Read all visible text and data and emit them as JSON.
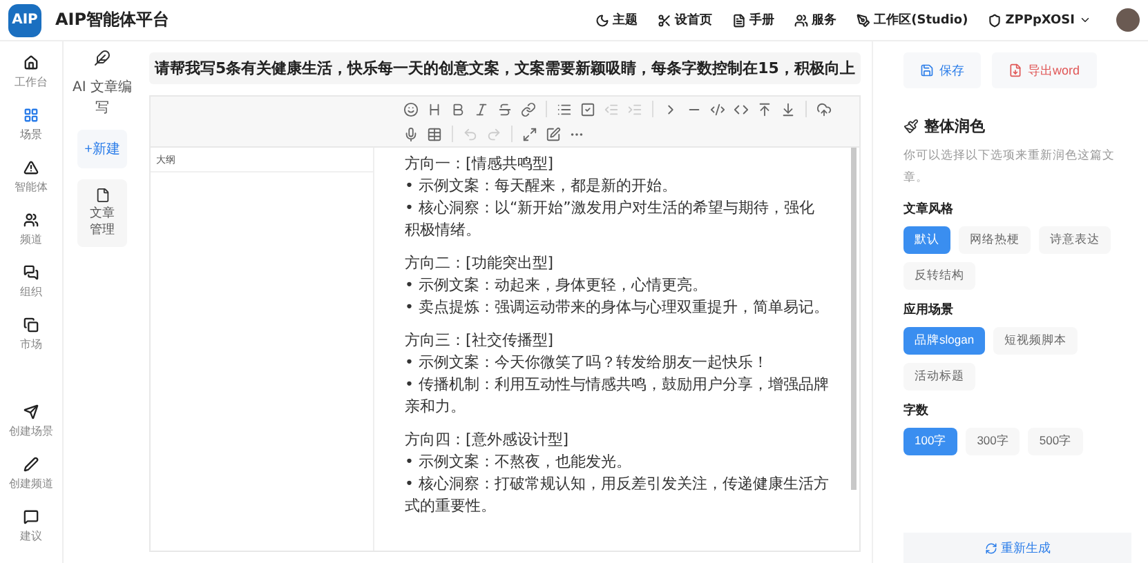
{
  "app": {
    "logo": "AIP",
    "title": "AIP智能体平台"
  },
  "header_links": [
    {
      "kind": "theme",
      "label": "主题"
    },
    {
      "kind": "home",
      "label": "设首页"
    },
    {
      "kind": "manual",
      "label": "手册"
    },
    {
      "kind": "service",
      "label": "服务"
    },
    {
      "kind": "studio",
      "label": "工作区(Studio)"
    },
    {
      "kind": "account",
      "label": "ZPPpXOSI"
    }
  ],
  "sidebar": {
    "items": [
      {
        "kind": "home",
        "label": "工作台",
        "selected": false
      },
      {
        "kind": "scene",
        "label": "场景",
        "selected": true
      },
      {
        "kind": "agent",
        "label": "智能体",
        "selected": false
      },
      {
        "kind": "channel",
        "label": "频道",
        "selected": false
      },
      {
        "kind": "org",
        "label": "组织",
        "selected": false
      },
      {
        "kind": "market",
        "label": "市场",
        "selected": false
      }
    ],
    "actions": [
      {
        "kind": "send",
        "label": "创建场景"
      },
      {
        "kind": "pen",
        "label": "创建频道"
      },
      {
        "kind": "chat",
        "label": "建议"
      }
    ]
  },
  "subnav": {
    "title": "AI 文章编写",
    "new_button": "+新建",
    "items": [
      {
        "label": "文章管理"
      }
    ]
  },
  "prompt": "请帮我写5条有关健康生活，快乐每一天的创意文案，文案需要新颖吸睛，每条字数控制在15，积极向上",
  "editor": {
    "outline_label": "大纲",
    "sections": [
      {
        "title": "方向一：[情感共鸣型]",
        "lines": [
          "• 示例文案：每天醒来，都是新的开始。",
          "• 核心洞察：以“新开始”激发用户对生活的希望与期待，强化积极情绪。"
        ]
      },
      {
        "title": "方向二：[功能突出型]",
        "lines": [
          "• 示例文案：动起来，身体更轻，心情更亮。",
          "• 卖点提炼：强调运动带来的身体与心理双重提升，简单易记。"
        ]
      },
      {
        "title": "方向三：[社交传播型]",
        "lines": [
          "• 示例文案：今天你微笑了吗？转发给朋友一起快乐！",
          "• 传播机制：利用互动性与情感共鸣，鼓励用户分享，增强品牌亲和力。"
        ]
      },
      {
        "title": "方向四：[意外感设计型]",
        "lines": [
          "• 示例文案：不熬夜，也能发光。",
          "• 核心洞察：打破常规认知，用反差引发关注，传递健康生活方式的重要性。"
        ]
      }
    ]
  },
  "panel": {
    "save": "保存",
    "export": "导出word",
    "heading": "整体润色",
    "description": "你可以选择以下选项来重新润色这篇文章。",
    "groups": [
      {
        "label": "文章风格",
        "options": [
          {
            "label": "默认",
            "selected": true
          },
          {
            "label": "网络热梗",
            "selected": false
          },
          {
            "label": "诗意表达",
            "selected": false
          },
          {
            "label": "反转结构",
            "selected": false
          }
        ]
      },
      {
        "label": "应用场景",
        "options": [
          {
            "label": "品牌slogan",
            "selected": true
          },
          {
            "label": "短视频脚本",
            "selected": false
          },
          {
            "label": "活动标题",
            "selected": false
          }
        ]
      },
      {
        "label": "字数",
        "options": [
          {
            "label": "100字",
            "selected": true
          },
          {
            "label": "300字",
            "selected": false
          },
          {
            "label": "500字",
            "selected": false
          }
        ]
      }
    ],
    "regenerate": "重新生成"
  }
}
